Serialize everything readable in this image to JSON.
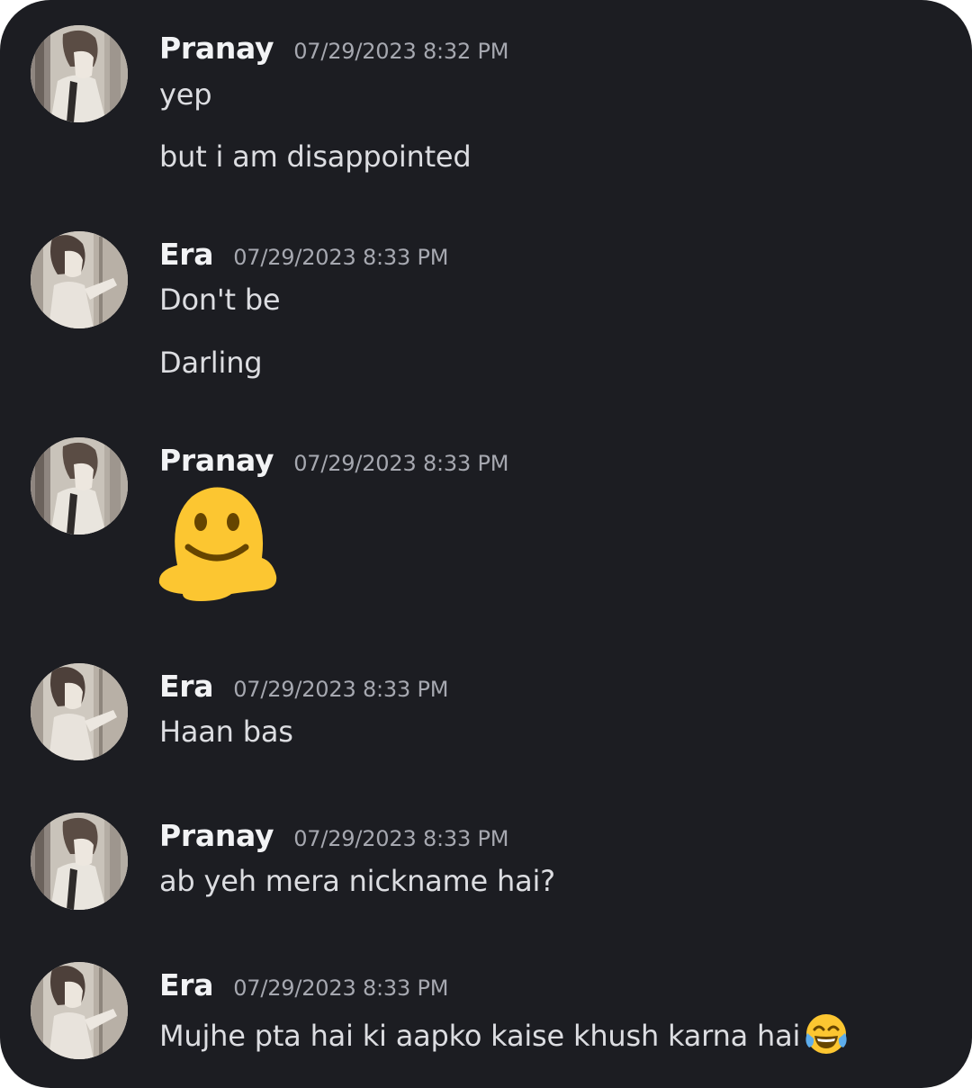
{
  "messages": [
    {
      "author": "Pranay",
      "avatar": "pranay-avatar",
      "timestamp": "07/29/2023 8:32 PM",
      "lines": [
        "yep",
        "but i am disappointed"
      ]
    },
    {
      "author": "Era",
      "avatar": "era-avatar",
      "timestamp": "07/29/2023 8:33 PM",
      "lines": [
        "Don't be",
        "Darling"
      ]
    },
    {
      "author": "Pranay",
      "avatar": "pranay-avatar",
      "timestamp": "07/29/2023 8:33 PM",
      "emoji": "melting-face-icon"
    },
    {
      "author": "Era",
      "avatar": "era-avatar",
      "timestamp": "07/29/2023 8:33 PM",
      "lines": [
        "Haan bas"
      ]
    },
    {
      "author": "Pranay",
      "avatar": "pranay-avatar",
      "timestamp": "07/29/2023 8:33 PM",
      "lines": [
        "ab yeh mera nickname hai?"
      ]
    },
    {
      "author": "Era",
      "avatar": "era-avatar",
      "timestamp": "07/29/2023 8:33 PM",
      "lines": [
        "Mujhe pta hai ki aapko kaise khush karna hai"
      ],
      "trailing_emoji": "face-with-tears-of-joy-icon"
    }
  ],
  "colors": {
    "background": "#1c1d22",
    "author_name": "#f2f3f5",
    "timestamp": "#a6a8b0",
    "message_text": "#dcdde1",
    "emoji_yellow": "#fcc631"
  }
}
